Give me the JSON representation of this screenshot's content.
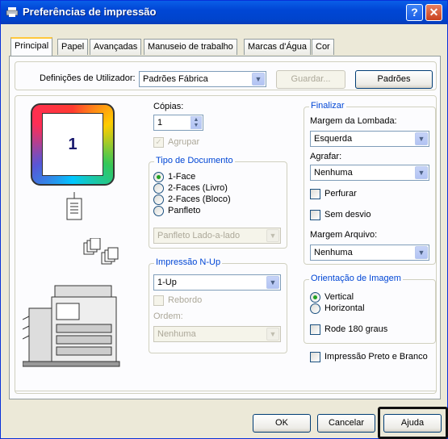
{
  "window": {
    "title": "Preferências de impressão",
    "help_glyph": "?",
    "close_glyph": "✕"
  },
  "tabs": [
    "Principal",
    "Papel",
    "Avançadas",
    "Manuseio de trabalho",
    "Marcas d'Água",
    "Cor"
  ],
  "top": {
    "user_settings_label": "Definições de Utilizador:",
    "user_settings_value": "Padrões Fábrica",
    "save_label": "Guardar...",
    "defaults_label": "Padrões"
  },
  "preview": {
    "copy_number": "1"
  },
  "copies": {
    "label": "Cópias:",
    "value": "1",
    "collate_label": "Agrupar"
  },
  "doc_type": {
    "title": "Tipo de Documento",
    "options": [
      "1-Face",
      "2-Faces (Livro)",
      "2-Faces (Bloco)",
      "Panfleto"
    ],
    "selected": 0,
    "booklet_value": "Panfleto Lado-a-lado"
  },
  "nup": {
    "title": "Impressão N-Up",
    "value": "1-Up",
    "border_label": "Rebordo",
    "order_label": "Ordem:",
    "order_value": "Nenhuma"
  },
  "finish": {
    "title": "Finalizar",
    "binding_label": "Margem da Lombada:",
    "binding_value": "Esquerda",
    "staple_label": "Agrafar:",
    "staple_value": "Nenhuma",
    "punch_label": "Perfurar",
    "offset_label": "Sem desvio",
    "margin_label": "Margem Arquivo:",
    "margin_value": "Nenhuma"
  },
  "orientation": {
    "title": "Orientação de Imagem",
    "options": [
      "Vertical",
      "Horizontal"
    ],
    "selected": 0,
    "rotate_label": "Rode 180 graus"
  },
  "bw_label": "Impressão Preto e Branco",
  "footer": {
    "ok": "OK",
    "cancel": "Cancelar",
    "help": "Ajuda"
  },
  "colors": {
    "title_bar": "#0046d5",
    "group_title": "#0046d5",
    "checked": "#21a121"
  }
}
